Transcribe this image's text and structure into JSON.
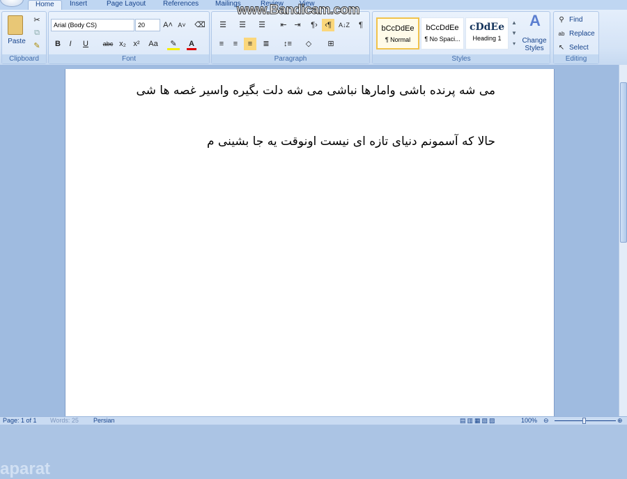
{
  "ribbon": {
    "tabs": [
      "Home",
      "Insert",
      "Page Layout",
      "References",
      "Mailings",
      "Review",
      "View"
    ],
    "clipboard": {
      "paste": "Paste",
      "label": "Clipboard"
    },
    "font": {
      "name": "Arial (Body CS)",
      "size": "20",
      "label": "Font",
      "bold": "B",
      "italic": "I",
      "underline": "U",
      "strike": "abc",
      "sub": "x₂",
      "sup": "x²",
      "case": "Aa",
      "grow": "A˄",
      "shrink": "A˅",
      "color": "A"
    },
    "paragraph": {
      "label": "Paragraph",
      "sort": "A↓Z",
      "pilcrow": "¶"
    },
    "styles": {
      "label": "Styles",
      "items": [
        {
          "preview": "bCcDdEe",
          "name": "¶ Normal"
        },
        {
          "preview": "bCcDdEe",
          "name": "¶ No Spaci..."
        },
        {
          "preview": "cDdEe",
          "name": "Heading 1"
        }
      ],
      "change_styles": "Change Styles"
    },
    "editing": {
      "label": "Editing",
      "find": "Find",
      "replace": "Replace",
      "select": "Select"
    }
  },
  "watermark": "www.Bandicam.com",
  "aparat": "aparat",
  "document": {
    "paragraphs": [
      "می شه پرنده باشی وامارها نباشی   می شه دلت بگیره واسیر غصه ها شی",
      "حالا که آسمونم دنیای تازه ای نیست   اونوقت یه جا بشینی م"
    ]
  },
  "status": {
    "page": "Page: 1 of 1",
    "words": "Words: 25",
    "language": "Persian",
    "zoom": "100%"
  },
  "colors": {
    "accent": "#15428b",
    "highlight": "#f1c24b"
  }
}
